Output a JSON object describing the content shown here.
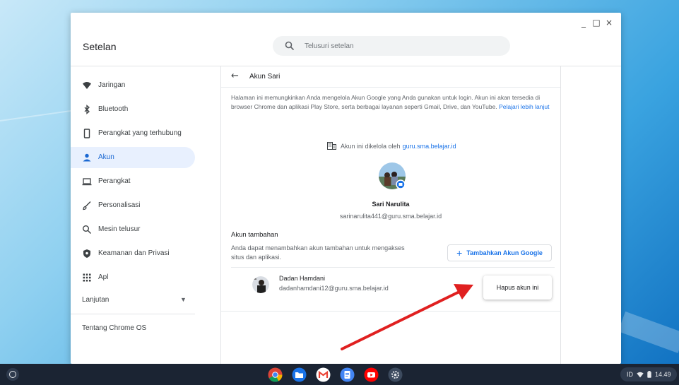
{
  "window": {
    "title": "Setelan",
    "controls": [
      "_",
      "□",
      "×"
    ]
  },
  "search": {
    "placeholder": "Telusuri setelan"
  },
  "sidebar": {
    "items": [
      {
        "label": "Jaringan",
        "icon": "wifi-icon"
      },
      {
        "label": "Bluetooth",
        "icon": "bluetooth-icon"
      },
      {
        "label": "Perangkat yang terhubung",
        "icon": "phone-icon"
      },
      {
        "label": "Akun",
        "icon": "person-icon",
        "active": true
      },
      {
        "label": "Perangkat",
        "icon": "laptop-icon"
      },
      {
        "label": "Personalisasi",
        "icon": "brush-icon"
      },
      {
        "label": "Mesin telusur",
        "icon": "search-icon"
      },
      {
        "label": "Keamanan dan Privasi",
        "icon": "shield-icon"
      },
      {
        "label": "Apl",
        "icon": "apps-grid-icon"
      }
    ],
    "advanced_label": "Lanjutan",
    "about_label": "Tentang Chrome OS"
  },
  "main": {
    "page_title": "Akun Sari",
    "description": "Halaman ini memungkinkan Anda mengelola Akun Google yang Anda gunakan untuk login. Akun ini akan tersedia di browser Chrome dan aplikasi Play Store, serta berbagai layanan seperti Gmail, Drive, dan YouTube.",
    "learn_more": "Pelajari lebih lanjut",
    "managed_prefix": "Akun ini dikelola oleh",
    "managed_domain": "guru.sma.belajar.id",
    "profile": {
      "name": "Sari Narulita",
      "email": "sarinarulita441@guru.sma.belajar.id"
    },
    "additional": {
      "title": "Akun tambahan",
      "description": "Anda dapat menambahkan akun tambahan untuk mengakses situs dan aplikasi.",
      "add_button": "Tambahkan Akun Google",
      "accounts": [
        {
          "name": "Dadan Hamdani",
          "email": "dadanhamdani12@guru.sma.belajar.id"
        }
      ],
      "context_menu_item": "Hapus akun ini"
    }
  },
  "shelf": {
    "apps": [
      "chrome-icon",
      "files-icon",
      "gmail-icon",
      "docs-icon",
      "youtube-icon",
      "settings-icon"
    ],
    "tray": {
      "language": "ID",
      "time": "14.49"
    }
  },
  "colors": {
    "accent": "#1a73e8",
    "active_bg": "#e8f0fe",
    "annotation_arrow": "#e02020"
  }
}
